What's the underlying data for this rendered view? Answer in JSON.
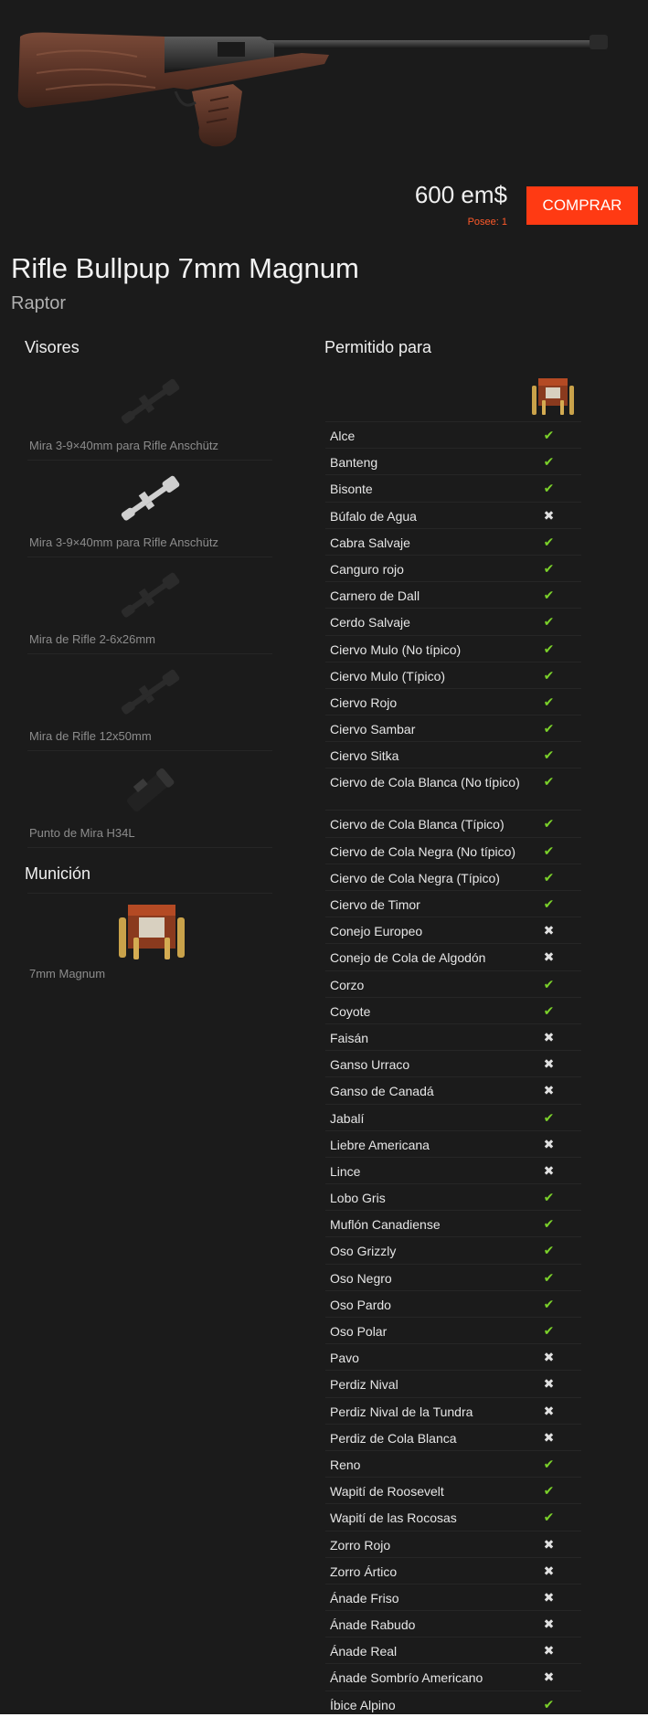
{
  "product": {
    "price": "600 em$",
    "owned": "Posee: 1",
    "buy_label": "COMPRAR",
    "name": "Rifle Bullpup 7mm Magnum",
    "brand": "Raptor"
  },
  "colors": {
    "accent": "#ff3a13",
    "allowed": "#7bd12a",
    "not_allowed": "#e0e0e0",
    "background": "#1b1b1b"
  },
  "scopes": {
    "heading": "Visores",
    "items": [
      {
        "name": "Mira 3-9×40mm para Rifle Anschütz",
        "icon": "scope-icon"
      },
      {
        "name": "Mira 3-9×40mm para Rifle Anschütz",
        "icon": "silver-scope-icon"
      },
      {
        "name": "Mira de Rifle 2-6x26mm",
        "icon": "scope-icon"
      },
      {
        "name": "Mira de Rifle 12x50mm",
        "icon": "scope-icon"
      },
      {
        "name": "Punto de Mira H34L",
        "icon": "red-dot-sight-icon"
      }
    ]
  },
  "ammo": {
    "heading": "Munición",
    "items": [
      {
        "name": "7mm Magnum",
        "icon": "ammo-box-icon"
      }
    ]
  },
  "allowed": {
    "heading": "Permitido para",
    "icon": "ammo-box-icon",
    "animals": [
      {
        "name": "Alce",
        "allowed": true
      },
      {
        "name": "Banteng",
        "allowed": true
      },
      {
        "name": "Bisonte",
        "allowed": true
      },
      {
        "name": "Búfalo de Agua",
        "allowed": false
      },
      {
        "name": "Cabra Salvaje",
        "allowed": true
      },
      {
        "name": "Canguro rojo",
        "allowed": true
      },
      {
        "name": "Carnero de Dall",
        "allowed": true
      },
      {
        "name": "Cerdo Salvaje",
        "allowed": true
      },
      {
        "name": "Ciervo Mulo (No típico)",
        "allowed": true
      },
      {
        "name": "Ciervo Mulo (Típico)",
        "allowed": true
      },
      {
        "name": "Ciervo Rojo",
        "allowed": true
      },
      {
        "name": "Ciervo Sambar",
        "allowed": true
      },
      {
        "name": "Ciervo Sitka",
        "allowed": true
      },
      {
        "name": "Ciervo de Cola Blanca (No típico)",
        "allowed": true
      },
      {
        "name": "Ciervo de Cola Blanca (Típico)",
        "allowed": true
      },
      {
        "name": "Ciervo de Cola Negra (No típico)",
        "allowed": true
      },
      {
        "name": "Ciervo de Cola Negra (Típico)",
        "allowed": true
      },
      {
        "name": "Ciervo de Timor",
        "allowed": true
      },
      {
        "name": "Conejo Europeo",
        "allowed": false
      },
      {
        "name": "Conejo de Cola de Algodón",
        "allowed": false
      },
      {
        "name": "Corzo",
        "allowed": true
      },
      {
        "name": "Coyote",
        "allowed": true
      },
      {
        "name": "Faisán",
        "allowed": false
      },
      {
        "name": "Ganso Urraco",
        "allowed": false
      },
      {
        "name": "Ganso de Canadá",
        "allowed": false
      },
      {
        "name": "Jabalí",
        "allowed": true
      },
      {
        "name": "Liebre Americana",
        "allowed": false
      },
      {
        "name": "Lince",
        "allowed": false
      },
      {
        "name": "Lobo Gris",
        "allowed": true
      },
      {
        "name": "Muflón Canadiense",
        "allowed": true
      },
      {
        "name": "Oso Grizzly",
        "allowed": true
      },
      {
        "name": "Oso Negro",
        "allowed": true
      },
      {
        "name": "Oso Pardo",
        "allowed": true
      },
      {
        "name": "Oso Polar",
        "allowed": true
      },
      {
        "name": "Pavo",
        "allowed": false
      },
      {
        "name": "Perdiz Nival",
        "allowed": false
      },
      {
        "name": "Perdiz Nival de la Tundra",
        "allowed": false
      },
      {
        "name": "Perdiz de Cola Blanca",
        "allowed": false
      },
      {
        "name": "Reno",
        "allowed": true
      },
      {
        "name": "Wapití de Roosevelt",
        "allowed": true
      },
      {
        "name": "Wapití de las Rocosas",
        "allowed": true
      },
      {
        "name": "Zorro Rojo",
        "allowed": false
      },
      {
        "name": "Zorro Ártico",
        "allowed": false
      },
      {
        "name": "Ánade Friso",
        "allowed": false
      },
      {
        "name": "Ánade Rabudo",
        "allowed": false
      },
      {
        "name": "Ánade Real",
        "allowed": false
      },
      {
        "name": "Ánade Sombrío Americano",
        "allowed": false
      },
      {
        "name": "Íbice Alpino",
        "allowed": true
      }
    ]
  }
}
